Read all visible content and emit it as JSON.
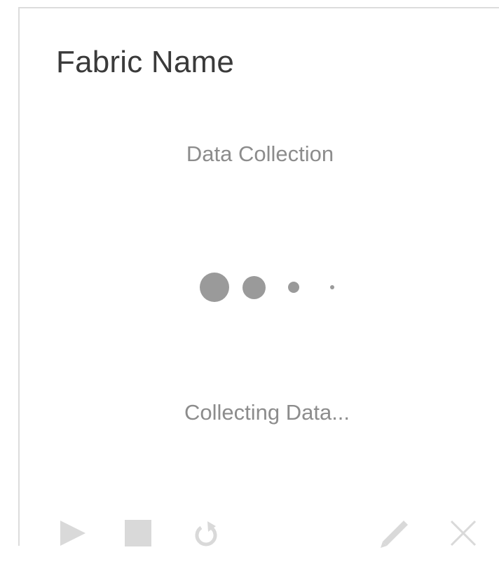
{
  "card": {
    "title": "Fabric Name",
    "subtitle": "Data Collection",
    "status_text": "Collecting Data..."
  },
  "toolbar": {
    "icons": {
      "play": "play-icon",
      "stop": "stop-icon",
      "refresh": "refresh-icon",
      "edit": "pencil-icon",
      "delete": "close-icon"
    }
  },
  "colors": {
    "icon_gray": "#d9d9d9",
    "dot_gray": "#9a9a9a",
    "text_gray": "#8c8c8c",
    "title": "#3a3a3a",
    "border": "#dcdcdc"
  }
}
